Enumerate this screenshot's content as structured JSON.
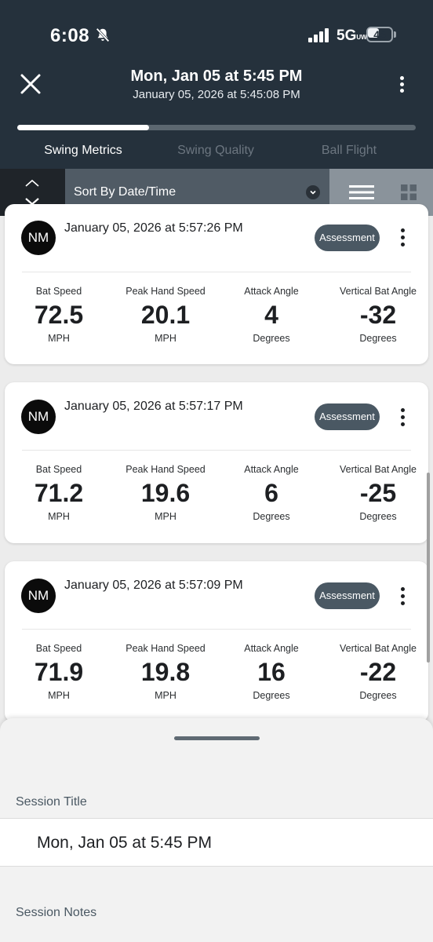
{
  "status_bar": {
    "time": "6:08",
    "network": "5G",
    "network_badge": "UW",
    "battery_level": "45",
    "battery_fraction": 0.45
  },
  "header": {
    "title": "Mon, Jan 05 at 5:45 PM",
    "subtitle": "January 05, 2026 at 5:45:08 PM",
    "progress_fraction": 0.33,
    "tabs": [
      {
        "label": "Swing Metrics",
        "active": true
      },
      {
        "label": "Swing Quality",
        "active": false
      },
      {
        "label": "Ball Flight",
        "active": false
      }
    ]
  },
  "sort": {
    "label": "Sort By Date/Time"
  },
  "swings": [
    {
      "avatar": "NM",
      "datetime": "January 05, 2026 at 5:57:26 PM",
      "assessment_label": "Assessment",
      "metrics": [
        {
          "label": "Bat Speed",
          "value": "72.5",
          "unit": "MPH"
        },
        {
          "label": "Peak Hand Speed",
          "value": "20.1",
          "unit": "MPH"
        },
        {
          "label": "Attack Angle",
          "value": "4",
          "unit": "Degrees"
        },
        {
          "label": "Vertical Bat Angle",
          "value": "-32",
          "unit": "Degrees"
        }
      ]
    },
    {
      "avatar": "NM",
      "datetime": "January 05, 2026 at 5:57:17 PM",
      "assessment_label": "Assessment",
      "metrics": [
        {
          "label": "Bat Speed",
          "value": "71.2",
          "unit": "MPH"
        },
        {
          "label": "Peak Hand Speed",
          "value": "19.6",
          "unit": "MPH"
        },
        {
          "label": "Attack Angle",
          "value": "6",
          "unit": "Degrees"
        },
        {
          "label": "Vertical Bat Angle",
          "value": "-25",
          "unit": "Degrees"
        }
      ]
    },
    {
      "avatar": "NM",
      "datetime": "January 05, 2026 at 5:57:09 PM",
      "assessment_label": "Assessment",
      "metrics": [
        {
          "label": "Bat Speed",
          "value": "71.9",
          "unit": "MPH"
        },
        {
          "label": "Peak Hand Speed",
          "value": "19.8",
          "unit": "MPH"
        },
        {
          "label": "Attack Angle",
          "value": "16",
          "unit": "Degrees"
        },
        {
          "label": "Vertical Bat Angle",
          "value": "-22",
          "unit": "Degrees"
        }
      ]
    }
  ],
  "sheet": {
    "session_title_label": "Session Title",
    "session_title_value": "Mon, Jan 05 at 5:45 PM",
    "session_notes_label": "Session Notes"
  },
  "colors": {
    "header_bg": "#25313c",
    "assessment_bg": "#4a5863",
    "sortbar_bg": "#505b65"
  },
  "icons": [
    "bell-slash-icon",
    "signal-icon",
    "battery-icon",
    "close-icon",
    "more-vertical-icon",
    "chevron-up-icon",
    "chevron-down-icon",
    "list-view-icon",
    "grid-view-icon"
  ]
}
